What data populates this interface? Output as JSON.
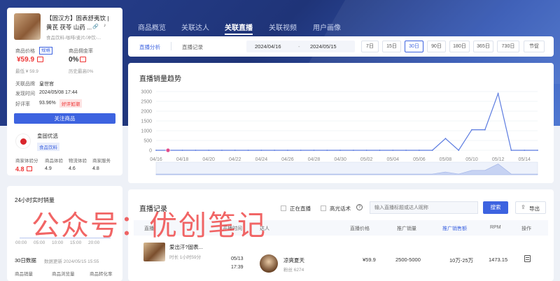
{
  "product": {
    "title": "【固汉方】固表舒夷饮 |",
    "subtitle": "黄芪 茯苓 山药 ...",
    "category": "食品饮料-咖啡/麦片/冲饮-...",
    "price_label": "商品价格",
    "price_badge": "规格",
    "price": "¥59.9",
    "lowest": "最低 ¥ 59.9",
    "commission_label": "商品佣金率",
    "commission": "0%",
    "commission_hist": "历史最高0%",
    "brand_label": "关联品牌",
    "brand": "皇世官",
    "time_label": "发现时间",
    "time": "2024/05/08 17:44",
    "rating_label": "好评率",
    "rating": "93.96%",
    "rating_badge": "好评如潮",
    "follow_button": "关注商品"
  },
  "shop": {
    "name": "皇固优选",
    "tag": "食品饮料",
    "headers": [
      "商家体验分",
      "商品体验",
      "物流体验",
      "商家服务"
    ],
    "values": [
      "4.8",
      "4.9",
      "4.6",
      "4.8"
    ]
  },
  "realtime": {
    "title": "24小时实时销量",
    "ticks": [
      "00:00",
      "05:00",
      "10:00",
      "15:00",
      "20:00"
    ],
    "thirty_title": "30日数据",
    "updated": "数据更新 2024/05/15 15:55",
    "cols": [
      "商品销量",
      "商品浏览量",
      "商品转化率"
    ]
  },
  "tabs": [
    "商品概览",
    "关联达人",
    "关联直播",
    "关联视频",
    "用户画像"
  ],
  "filter": {
    "subtabs": [
      "直播分析",
      "直播记录"
    ],
    "date_start": "2024/04/16",
    "date_sep": "-",
    "date_end": "2024/05/15",
    "ranges": [
      "7日",
      "15日",
      "30日",
      "90日",
      "180日",
      "365日",
      "730日",
      "节促"
    ]
  },
  "chart_data": {
    "type": "line",
    "title": "直播销量趋势",
    "x": [
      "04/16",
      "04/17",
      "04/18",
      "04/19",
      "04/20",
      "04/21",
      "04/22",
      "04/23",
      "04/24",
      "04/25",
      "04/26",
      "04/27",
      "04/28",
      "04/29",
      "04/30",
      "05/01",
      "05/02",
      "05/03",
      "05/04",
      "05/05",
      "05/06",
      "05/07",
      "05/08",
      "05/09",
      "05/10",
      "05/11",
      "05/12",
      "05/13",
      "05/14",
      "05/15"
    ],
    "xticks": [
      "04/16",
      "04/18",
      "04/20",
      "04/22",
      "04/24",
      "04/26",
      "04/28",
      "04/30",
      "05/02",
      "05/04",
      "05/06",
      "05/08",
      "05/10",
      "05/12",
      "05/14"
    ],
    "values": [
      0,
      0,
      0,
      0,
      0,
      0,
      0,
      0,
      0,
      0,
      0,
      0,
      0,
      0,
      0,
      0,
      0,
      0,
      0,
      0,
      0,
      0,
      600,
      0,
      1050,
      1050,
      2900,
      0,
      0,
      0
    ],
    "yticks": [
      "3000",
      "2500",
      "2000",
      "1500",
      "1000",
      "500",
      "0"
    ],
    "ylim": [
      0,
      3000
    ],
    "color": "#5b7be0"
  },
  "records": {
    "title": "直播记录",
    "chk_live": "正在直播",
    "chk_ad": "高光话术",
    "search_placeholder": "输入直播标题或达人昵称",
    "search_btn": "搜索",
    "export_btn": "导出",
    "headers": [
      "直播",
      "开播时间",
      "达人",
      "直播价格",
      "推广销量",
      "推广销售额",
      "RPM",
      "操作"
    ],
    "rows": [
      {
        "title": "爱出汗?固表...",
        "duration": "时长 1小时59分",
        "date": "05/13",
        "time": "17:39",
        "streamer": "凉爽夏天",
        "fans": "粉丝 6274",
        "price": "¥59.9",
        "sales": "2500-5000",
        "revenue": "10万-25万",
        "rpm": "1473.15"
      }
    ]
  },
  "watermark": "公众号：优创笔记"
}
